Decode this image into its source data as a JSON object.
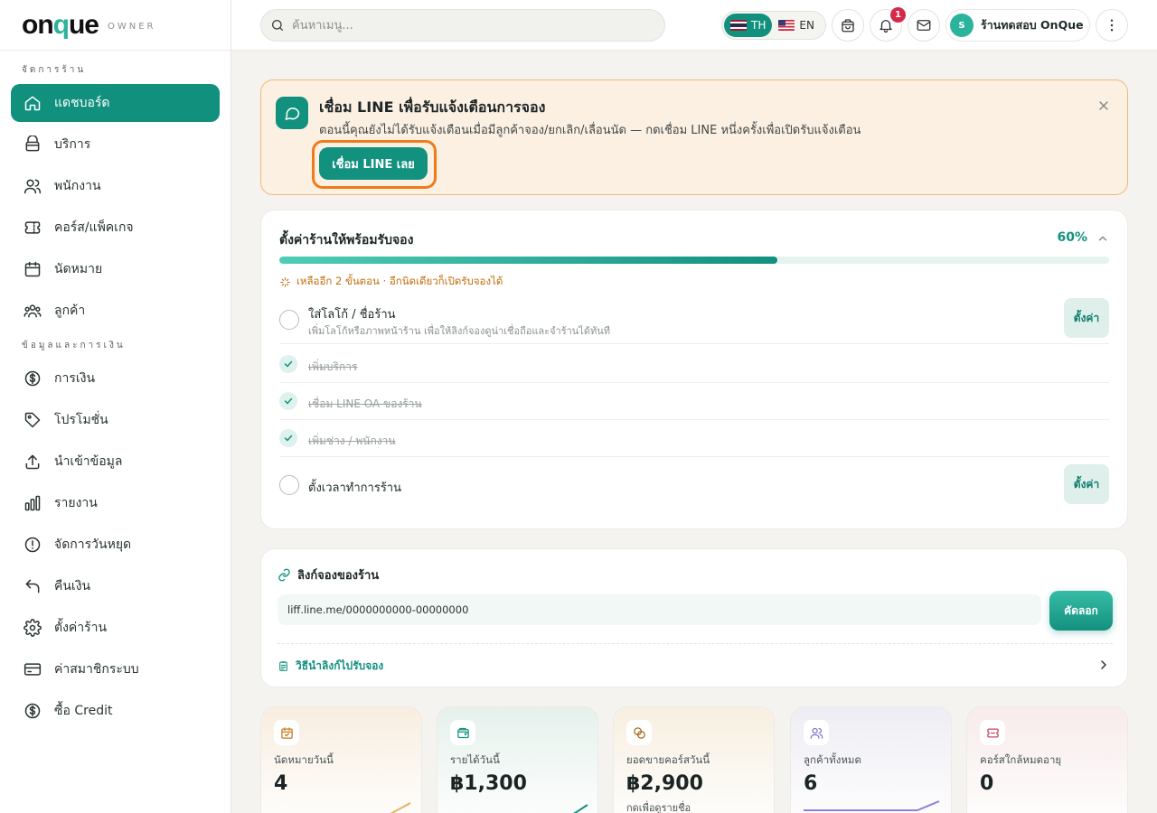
{
  "brand": {
    "logo_part1": "on",
    "logo_part2": "q",
    "logo_part3": "ue",
    "subtitle": "OWNER",
    "accent": "#12907e"
  },
  "sidebar": {
    "section1": "จัดการร้าน",
    "section2": "ข้อมูลและการเงิน",
    "items1": [
      {
        "label": "แดชบอร์ด",
        "icon": "home-icon",
        "active": true
      },
      {
        "label": "บริการ",
        "icon": "service-icon"
      },
      {
        "label": "พนักงาน",
        "icon": "staff-icon"
      },
      {
        "label": "คอร์ส/แพ็คเกจ",
        "icon": "ticket-icon"
      },
      {
        "label": "นัดหมาย",
        "icon": "calendar-icon"
      },
      {
        "label": "ลูกค้า",
        "icon": "customers-icon"
      }
    ],
    "items2": [
      {
        "label": "การเงิน",
        "icon": "dollar-icon"
      },
      {
        "label": "โปรโมชั่น",
        "icon": "tag-icon"
      },
      {
        "label": "นำเข้าข้อมูล",
        "icon": "upload-icon"
      },
      {
        "label": "รายงาน",
        "icon": "chart-icon"
      },
      {
        "label": "จัดการวันหยุด",
        "icon": "alert-icon"
      },
      {
        "label": "คืนเงิน",
        "icon": "refund-icon"
      },
      {
        "label": "ตั้งค่าร้าน",
        "icon": "gear-icon"
      },
      {
        "label": "ค่าสมาชิกระบบ",
        "icon": "card-icon"
      },
      {
        "label": "ซื้อ Credit",
        "icon": "coin-icon"
      }
    ]
  },
  "header": {
    "search_placeholder": "ค้นหาเมนู...",
    "lang_th": "TH",
    "lang_en": "EN",
    "notif_count": "1",
    "avatar_initial": "S",
    "profile_name": "ร้านทดสอบ OnQue"
  },
  "line_banner": {
    "title": "เชื่อม LINE เพื่อรับแจ้งเตือนการจอง",
    "desc": "ตอนนี้คุณยังไม่ได้รับแจ้งเตือนเมื่อมีลูกค้าจอง/ยกเลิก/เลื่อนนัด — กดเชื่อม LINE หนึ่งครั้งเพื่อเปิดรับแจ้งเตือน",
    "button": "เชื่อม LINE เลย"
  },
  "setup": {
    "title": "ตั้งค่าร้านให้พร้อมรับจอง",
    "percent_label": "60%",
    "progress": 0.6,
    "remaining": "เหลืออีก 2 ขั้นตอน · อีกนิดเดียวก็เปิดรับจองได้",
    "tasks": [
      {
        "label": "ใส่โลโก้ / ชื่อร้าน",
        "desc": "เพิ่มโลโก้หรือภาพหน้าร้าน เพื่อให้ลิงก์จองดูน่าเชื่อถือและจำร้านได้ทันที",
        "done": false,
        "action": "ตั้งค่า"
      },
      {
        "label": "เพิ่มบริการ",
        "done": true
      },
      {
        "label": "เชื่อม LINE OA ของร้าน",
        "done": true
      },
      {
        "label": "เพิ่มช่าง / พนักงาน",
        "done": true
      },
      {
        "label": "ตั้งเวลาทำการร้าน",
        "done": false,
        "action": "ตั้งค่า"
      }
    ]
  },
  "booking_link": {
    "title": "ลิงก์จองของร้าน",
    "url": "liff.line.me/0000000000-00000000",
    "copy": "คัดลอก",
    "howto": "วิธีนำลิงก์ไปรับจอง"
  },
  "stats": [
    {
      "label": "นัดหมายวันนี้",
      "value": "4",
      "icon": "calendar-check-icon",
      "color": "#c77a1e",
      "bg": "#f8eee0"
    },
    {
      "label": "รายได้วันนี้",
      "value": "฿1,300",
      "icon": "wallet-icon",
      "color": "#15907e",
      "bg": "#e6f1ec"
    },
    {
      "label": "ยอดขายคอร์สวันนี้",
      "value": "฿2,900",
      "sub": "กดเพื่อดูรายชื่อ",
      "icon": "coins-icon",
      "color": "#a56a18",
      "bg": "#f7efe0"
    },
    {
      "label": "ลูกค้าทั้งหมด",
      "value": "6",
      "icon": "users-icon",
      "color": "#7c74c9",
      "bg": "#eeedf3"
    },
    {
      "label": "คอร์สใกล้หมดอายุ",
      "value": "0",
      "icon": "ticket-alert-icon",
      "color": "#c9445e",
      "bg": "#f8ebeb"
    }
  ]
}
